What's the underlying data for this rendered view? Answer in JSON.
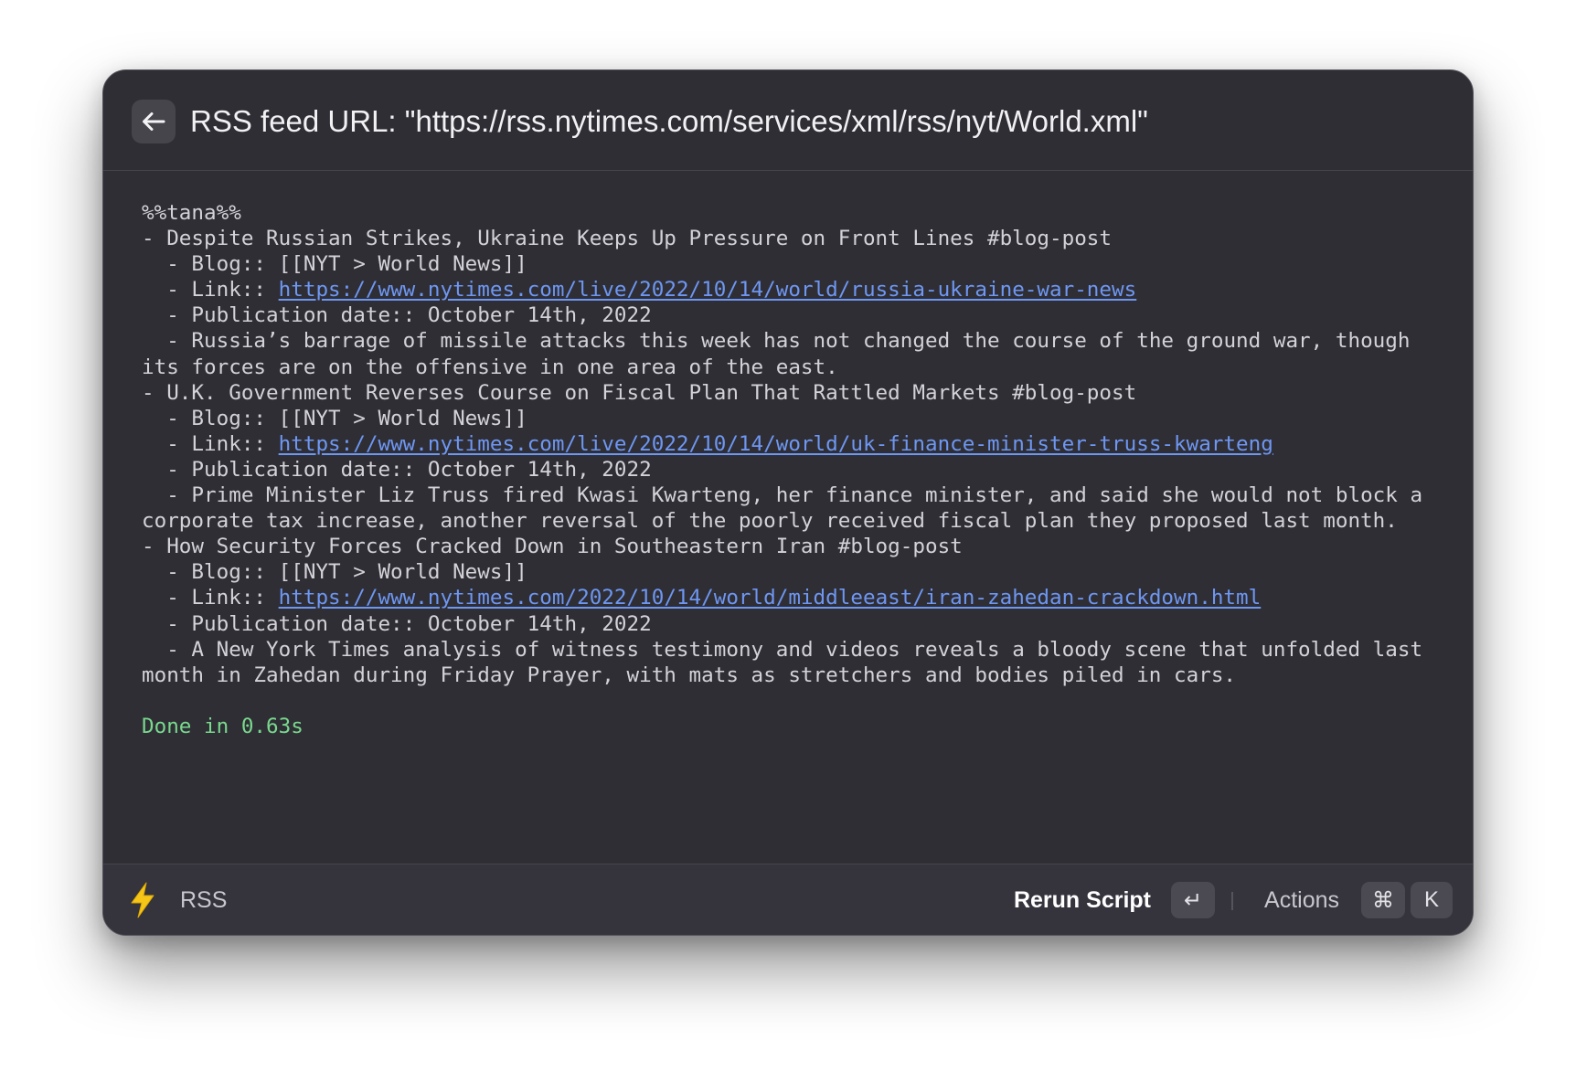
{
  "header": {
    "back_icon": "arrow-left-icon",
    "title": "RSS feed URL: \"https://rss.nytimes.com/services/xml/rss/nyt/World.xml\""
  },
  "output": {
    "marker": "%%tana%%",
    "items": [
      {
        "title_line": "- Despite Russian Strikes, Ukraine Keeps Up Pressure on Front Lines #blog-post",
        "blog_line": "  - Blog:: [[NYT > World News]]",
        "link_prefix": "  - Link:: ",
        "link_url": "https://www.nytimes.com/live/2022/10/14/world/russia-ukraine-war-news",
        "date_line": "  - Publication date:: October 14th, 2022",
        "summary_line": "  - Russia’s barrage of missile attacks this week has not changed the course of the ground war, though its forces are on the offensive in one area of the east."
      },
      {
        "title_line": "- U.K. Government Reverses Course on Fiscal Plan That Rattled Markets #blog-post",
        "blog_line": "  - Blog:: [[NYT > World News]]",
        "link_prefix": "  - Link:: ",
        "link_url": "https://www.nytimes.com/live/2022/10/14/world/uk-finance-minister-truss-kwarteng",
        "date_line": "  - Publication date:: October 14th, 2022",
        "summary_line": "  - Prime Minister Liz Truss fired Kwasi Kwarteng, her finance minister, and said she would not block a corporate tax increase, another reversal of the poorly received fiscal plan they proposed last month."
      },
      {
        "title_line": "- How Security Forces Cracked Down in Southeastern Iran #blog-post",
        "blog_line": "  - Blog:: [[NYT > World News]]",
        "link_prefix": "  - Link:: ",
        "link_url": "https://www.nytimes.com/2022/10/14/world/middleeast/iran-zahedan-crackdown.html",
        "date_line": "  - Publication date:: October 14th, 2022",
        "summary_line": "  - A New York Times analysis of witness testimony and videos reveals a bloody scene that unfolded last month in Zahedan during Friday Prayer, with mats as stretchers and bodies piled in cars."
      }
    ],
    "status": "Done in 0.63s"
  },
  "footer": {
    "extension_icon": "lightning-bolt-icon",
    "extension_name": "RSS",
    "primary_action": "Rerun Script",
    "primary_shortcut": "↵",
    "actions_label": "Actions",
    "actions_shortcut_modifier": "⌘",
    "actions_shortcut_key": "K"
  },
  "colors": {
    "window_bg": "#2f2e35",
    "footer_bg": "#35333c",
    "text": "#d3d2d8",
    "link": "#6e97f2",
    "success": "#79d98d",
    "bolt": "#f5c518"
  }
}
